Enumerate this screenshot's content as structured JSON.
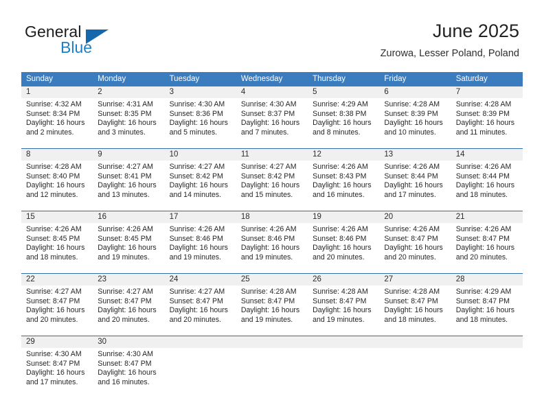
{
  "brand": {
    "name_part1": "General",
    "name_part2": "Blue",
    "accent_color": "#1668ad",
    "text_color": "#1c1c1c"
  },
  "header": {
    "title": "June 2025",
    "subtitle": "Zurowa, Lesser Poland, Poland"
  },
  "theme": {
    "header_row_bg": "#3b7cbf",
    "week_separator": "#2f6ca8",
    "daynum_band_bg": "#f0f0f0",
    "page_bg": "#ffffff"
  },
  "weekdays": [
    "Sunday",
    "Monday",
    "Tuesday",
    "Wednesday",
    "Thursday",
    "Friday",
    "Saturday"
  ],
  "weeks": [
    {
      "days": [
        {
          "num": "1",
          "sunrise": "Sunrise: 4:32 AM",
          "sunset": "Sunset: 8:34 PM",
          "daylight1": "Daylight: 16 hours",
          "daylight2": "and 2 minutes."
        },
        {
          "num": "2",
          "sunrise": "Sunrise: 4:31 AM",
          "sunset": "Sunset: 8:35 PM",
          "daylight1": "Daylight: 16 hours",
          "daylight2": "and 3 minutes."
        },
        {
          "num": "3",
          "sunrise": "Sunrise: 4:30 AM",
          "sunset": "Sunset: 8:36 PM",
          "daylight1": "Daylight: 16 hours",
          "daylight2": "and 5 minutes."
        },
        {
          "num": "4",
          "sunrise": "Sunrise: 4:30 AM",
          "sunset": "Sunset: 8:37 PM",
          "daylight1": "Daylight: 16 hours",
          "daylight2": "and 7 minutes."
        },
        {
          "num": "5",
          "sunrise": "Sunrise: 4:29 AM",
          "sunset": "Sunset: 8:38 PM",
          "daylight1": "Daylight: 16 hours",
          "daylight2": "and 8 minutes."
        },
        {
          "num": "6",
          "sunrise": "Sunrise: 4:28 AM",
          "sunset": "Sunset: 8:39 PM",
          "daylight1": "Daylight: 16 hours",
          "daylight2": "and 10 minutes."
        },
        {
          "num": "7",
          "sunrise": "Sunrise: 4:28 AM",
          "sunset": "Sunset: 8:39 PM",
          "daylight1": "Daylight: 16 hours",
          "daylight2": "and 11 minutes."
        }
      ]
    },
    {
      "days": [
        {
          "num": "8",
          "sunrise": "Sunrise: 4:28 AM",
          "sunset": "Sunset: 8:40 PM",
          "daylight1": "Daylight: 16 hours",
          "daylight2": "and 12 minutes."
        },
        {
          "num": "9",
          "sunrise": "Sunrise: 4:27 AM",
          "sunset": "Sunset: 8:41 PM",
          "daylight1": "Daylight: 16 hours",
          "daylight2": "and 13 minutes."
        },
        {
          "num": "10",
          "sunrise": "Sunrise: 4:27 AM",
          "sunset": "Sunset: 8:42 PM",
          "daylight1": "Daylight: 16 hours",
          "daylight2": "and 14 minutes."
        },
        {
          "num": "11",
          "sunrise": "Sunrise: 4:27 AM",
          "sunset": "Sunset: 8:42 PM",
          "daylight1": "Daylight: 16 hours",
          "daylight2": "and 15 minutes."
        },
        {
          "num": "12",
          "sunrise": "Sunrise: 4:26 AM",
          "sunset": "Sunset: 8:43 PM",
          "daylight1": "Daylight: 16 hours",
          "daylight2": "and 16 minutes."
        },
        {
          "num": "13",
          "sunrise": "Sunrise: 4:26 AM",
          "sunset": "Sunset: 8:44 PM",
          "daylight1": "Daylight: 16 hours",
          "daylight2": "and 17 minutes."
        },
        {
          "num": "14",
          "sunrise": "Sunrise: 4:26 AM",
          "sunset": "Sunset: 8:44 PM",
          "daylight1": "Daylight: 16 hours",
          "daylight2": "and 18 minutes."
        }
      ]
    },
    {
      "days": [
        {
          "num": "15",
          "sunrise": "Sunrise: 4:26 AM",
          "sunset": "Sunset: 8:45 PM",
          "daylight1": "Daylight: 16 hours",
          "daylight2": "and 18 minutes."
        },
        {
          "num": "16",
          "sunrise": "Sunrise: 4:26 AM",
          "sunset": "Sunset: 8:45 PM",
          "daylight1": "Daylight: 16 hours",
          "daylight2": "and 19 minutes."
        },
        {
          "num": "17",
          "sunrise": "Sunrise: 4:26 AM",
          "sunset": "Sunset: 8:46 PM",
          "daylight1": "Daylight: 16 hours",
          "daylight2": "and 19 minutes."
        },
        {
          "num": "18",
          "sunrise": "Sunrise: 4:26 AM",
          "sunset": "Sunset: 8:46 PM",
          "daylight1": "Daylight: 16 hours",
          "daylight2": "and 19 minutes."
        },
        {
          "num": "19",
          "sunrise": "Sunrise: 4:26 AM",
          "sunset": "Sunset: 8:46 PM",
          "daylight1": "Daylight: 16 hours",
          "daylight2": "and 20 minutes."
        },
        {
          "num": "20",
          "sunrise": "Sunrise: 4:26 AM",
          "sunset": "Sunset: 8:47 PM",
          "daylight1": "Daylight: 16 hours",
          "daylight2": "and 20 minutes."
        },
        {
          "num": "21",
          "sunrise": "Sunrise: 4:26 AM",
          "sunset": "Sunset: 8:47 PM",
          "daylight1": "Daylight: 16 hours",
          "daylight2": "and 20 minutes."
        }
      ]
    },
    {
      "days": [
        {
          "num": "22",
          "sunrise": "Sunrise: 4:27 AM",
          "sunset": "Sunset: 8:47 PM",
          "daylight1": "Daylight: 16 hours",
          "daylight2": "and 20 minutes."
        },
        {
          "num": "23",
          "sunrise": "Sunrise: 4:27 AM",
          "sunset": "Sunset: 8:47 PM",
          "daylight1": "Daylight: 16 hours",
          "daylight2": "and 20 minutes."
        },
        {
          "num": "24",
          "sunrise": "Sunrise: 4:27 AM",
          "sunset": "Sunset: 8:47 PM",
          "daylight1": "Daylight: 16 hours",
          "daylight2": "and 20 minutes."
        },
        {
          "num": "25",
          "sunrise": "Sunrise: 4:28 AM",
          "sunset": "Sunset: 8:47 PM",
          "daylight1": "Daylight: 16 hours",
          "daylight2": "and 19 minutes."
        },
        {
          "num": "26",
          "sunrise": "Sunrise: 4:28 AM",
          "sunset": "Sunset: 8:47 PM",
          "daylight1": "Daylight: 16 hours",
          "daylight2": "and 19 minutes."
        },
        {
          "num": "27",
          "sunrise": "Sunrise: 4:28 AM",
          "sunset": "Sunset: 8:47 PM",
          "daylight1": "Daylight: 16 hours",
          "daylight2": "and 18 minutes."
        },
        {
          "num": "28",
          "sunrise": "Sunrise: 4:29 AM",
          "sunset": "Sunset: 8:47 PM",
          "daylight1": "Daylight: 16 hours",
          "daylight2": "and 18 minutes."
        }
      ]
    },
    {
      "days": [
        {
          "num": "29",
          "sunrise": "Sunrise: 4:30 AM",
          "sunset": "Sunset: 8:47 PM",
          "daylight1": "Daylight: 16 hours",
          "daylight2": "and 17 minutes."
        },
        {
          "num": "30",
          "sunrise": "Sunrise: 4:30 AM",
          "sunset": "Sunset: 8:47 PM",
          "daylight1": "Daylight: 16 hours",
          "daylight2": "and 16 minutes."
        },
        {
          "num": "",
          "sunrise": "",
          "sunset": "",
          "daylight1": "",
          "daylight2": ""
        },
        {
          "num": "",
          "sunrise": "",
          "sunset": "",
          "daylight1": "",
          "daylight2": ""
        },
        {
          "num": "",
          "sunrise": "",
          "sunset": "",
          "daylight1": "",
          "daylight2": ""
        },
        {
          "num": "",
          "sunrise": "",
          "sunset": "",
          "daylight1": "",
          "daylight2": ""
        },
        {
          "num": "",
          "sunrise": "",
          "sunset": "",
          "daylight1": "",
          "daylight2": ""
        }
      ]
    }
  ]
}
